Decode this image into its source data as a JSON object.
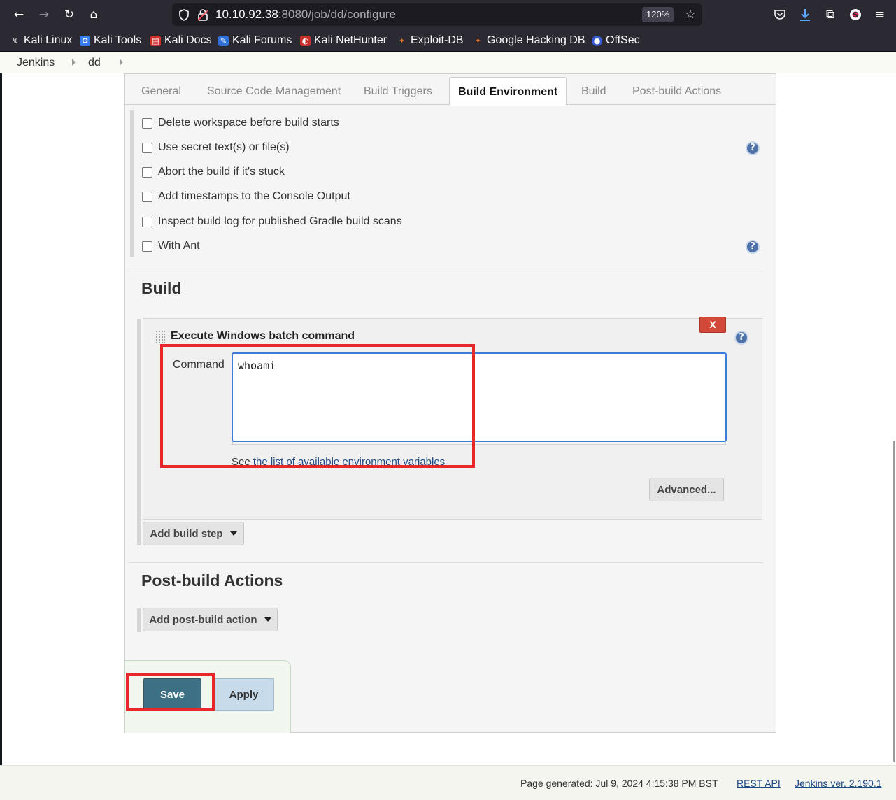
{
  "browser": {
    "url_host": "10.10.92.38",
    "url_rest": ":8080/job/dd/configure",
    "zoom": "120%",
    "bookmarks": [
      "Kali Linux",
      "Kali Tools",
      "Kali Docs",
      "Kali Forums",
      "Kali NetHunter",
      "Exploit-DB",
      "Google Hacking DB",
      "OffSec"
    ]
  },
  "breadcrumb": [
    "Jenkins",
    "dd"
  ],
  "tabs": [
    "General",
    "Source Code Management",
    "Build Triggers",
    "Build Environment",
    "Build",
    "Post-build Actions"
  ],
  "active_tab": "Build Environment",
  "build_environment": {
    "options": [
      "Delete workspace before build starts",
      "Use secret text(s) or file(s)",
      "Abort the build if it's stuck",
      "Add timestamps to the Console Output",
      "Inspect build log for published Gradle build scans",
      "With Ant"
    ],
    "checked": [
      false,
      false,
      false,
      false,
      false,
      false
    ]
  },
  "build": {
    "title": "Build",
    "step_title": "Execute Windows batch command",
    "delete_label": "X",
    "help_glyph": "?",
    "command_label": "Command",
    "command_value": "whoami",
    "see_prefix": "See ",
    "see_link": "the list of available environment variables",
    "advanced_label": "Advanced...",
    "add_step_label": "Add build step"
  },
  "post_build": {
    "title": "Post-build Actions",
    "add_action_label": "Add post-build action"
  },
  "buttons": {
    "save": "Save",
    "apply": "Apply"
  },
  "footer": {
    "generated": "Page generated: Jul 9, 2024 4:15:38 PM BST",
    "rest_api": "REST API",
    "version": "Jenkins ver. 2.190.1"
  },
  "colors": {
    "highlight": "#e8272b",
    "save_button": "#3d7084",
    "apply_button": "#c8dbea",
    "delete_button": "#d24939"
  }
}
